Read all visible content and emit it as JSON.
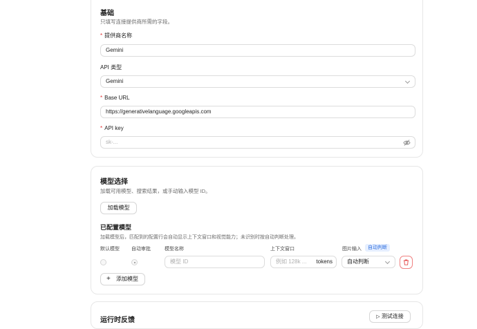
{
  "basic": {
    "title": "基础",
    "desc": "只填写连接提供商所需的字段。",
    "provider_name_label": "提供商名称",
    "provider_name_value": "Gemini",
    "api_type_label": "API 类型",
    "api_type_value": "Gemini",
    "base_url_label": "Base URL",
    "base_url_value": "https://generativelanguage.googleapis.com",
    "api_key_label": "API key",
    "api_key_placeholder": "sk-..."
  },
  "model": {
    "title": "模型选择",
    "desc": "加载可用模型、搜索结果，或手动输入模型 ID。",
    "load_button": "加载模型",
    "configured_title": "已配置模型",
    "configured_desc": "加载模型后，匹配到的配置行会自动显示上下文窗口和视觉能力；未识别时按自动判断处理。",
    "columns": {
      "default": "默认模型",
      "auto_review": "自动审批",
      "name": "模型名称",
      "context": "上下文窗口",
      "image": "图片输入",
      "image_badge": "自动判断"
    },
    "row": {
      "name_placeholder": "模型 ID",
      "context_placeholder": "例如 128k ...",
      "context_unit": "tokens",
      "image_value": "自动判断"
    },
    "add_button": "添加模型"
  },
  "run": {
    "title": "运行时反馈",
    "button": "测试连接"
  }
}
